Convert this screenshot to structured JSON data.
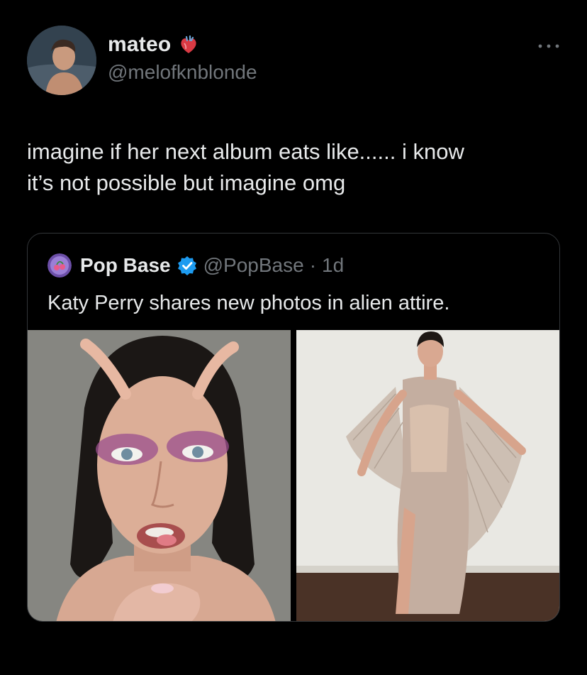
{
  "tweet": {
    "display_name": "mateo",
    "name_emoji": "anatomical-heart-icon",
    "handle": "@melofknblonde",
    "more_icon": "more-options-icon",
    "text": "imagine if her next album eats like...... i know\nit’s not possible but imagine omg"
  },
  "quote": {
    "display_name": "Pop Base",
    "verified_icon": "verified-badge-icon",
    "handle": "@PopBase",
    "separator": "·",
    "time": "1d",
    "text": "Katy Perry shares new photos in alien attire.",
    "photos": [
      "alien makeup close-up portrait",
      "full-length metallic pleated gown"
    ]
  },
  "colors": {
    "background": "#000000",
    "primary_text": "#e7e9ea",
    "secondary_text": "#71767b",
    "border": "#333639",
    "verified": "#1d9bf0"
  }
}
